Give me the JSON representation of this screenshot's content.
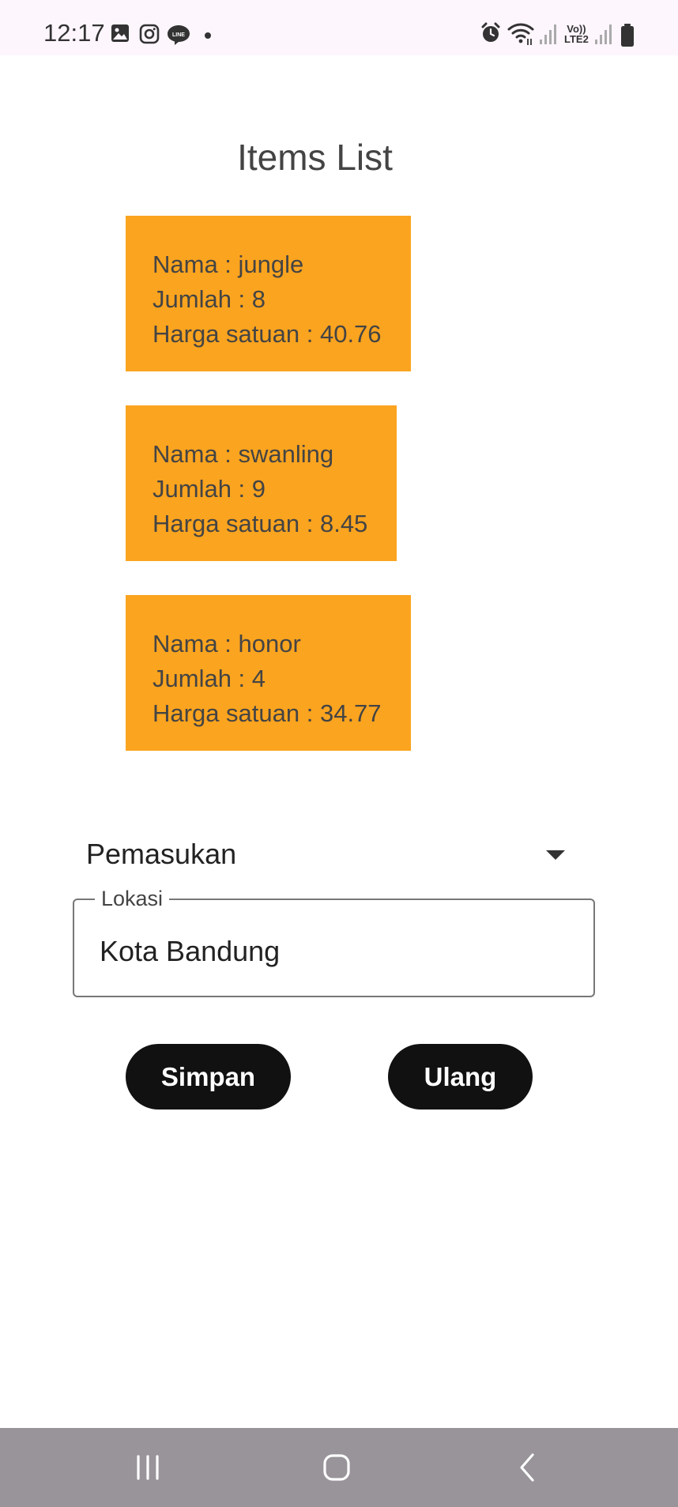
{
  "status_bar": {
    "time": "12:17",
    "left_icons": [
      "gallery-icon",
      "instagram-icon",
      "line-icon",
      "dot-icon"
    ],
    "right_icons": [
      "alarm-icon",
      "wifi-icon",
      "signal-icon",
      "volte-icon",
      "signal-icon",
      "battery-icon"
    ],
    "volte_line1": "Vo))",
    "volte_line2": "LTE2"
  },
  "page": {
    "title": "Items List"
  },
  "items": [
    {
      "name_line": "Nama : jungle",
      "qty_line": "Jumlah : 8",
      "price_line": "Harga satuan : 40.76"
    },
    {
      "name_line": "Nama : swanling",
      "qty_line": "Jumlah : 9",
      "price_line": "Harga satuan : 8.45"
    },
    {
      "name_line": "Nama : honor",
      "qty_line": "Jumlah : 4",
      "price_line": "Harga satuan : 34.77"
    }
  ],
  "form": {
    "category_selected": "Pemasukan",
    "location_label": "Lokasi",
    "location_value": "Kota Bandung",
    "save_label": "Simpan",
    "reset_label": "Ulang"
  },
  "colors": {
    "card": "#fba41f",
    "button": "#111111",
    "status_bar": "#fdf6fd",
    "nav_bar": "#98949a"
  },
  "nav_bar": {
    "buttons": [
      "recent-apps-icon",
      "home-icon",
      "back-icon"
    ]
  }
}
